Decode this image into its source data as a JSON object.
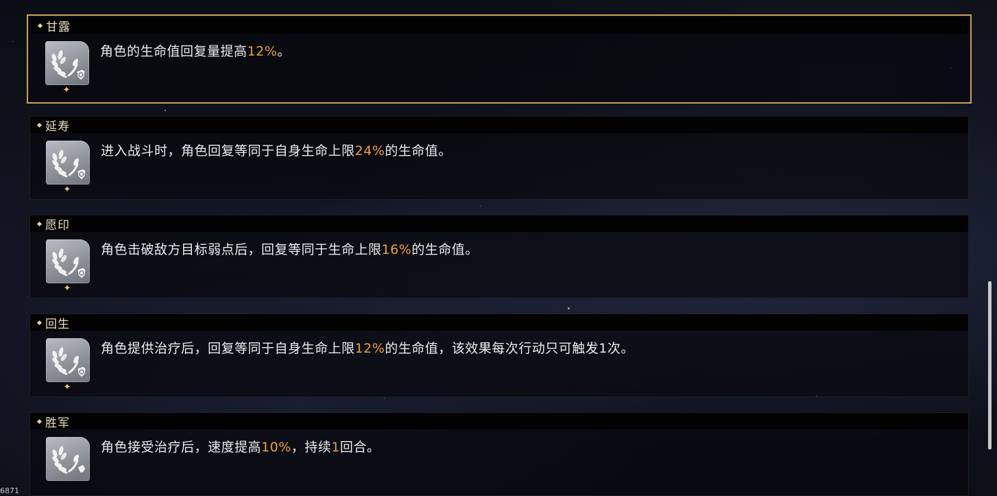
{
  "blessings": [
    {
      "name": "甘露",
      "selected": true,
      "desc_parts": [
        "角色的生命值回复量提高",
        "12%",
        "。"
      ]
    },
    {
      "name": "延寿",
      "selected": false,
      "desc_parts": [
        "进入战斗时，角色回复等同于自身生命上限",
        "24%",
        "的生命值。"
      ]
    },
    {
      "name": "愿印",
      "selected": false,
      "desc_parts": [
        "角色击破敌方目标弱点后，回复等同于生命上限",
        "16%",
        "的生命值。"
      ]
    },
    {
      "name": "回生",
      "selected": false,
      "desc_parts": [
        "角色提供治疗后，回复等同于自身生命上限",
        "12%",
        "的生命值，该效果每次行动只可触发1次。"
      ]
    },
    {
      "name": "胜军",
      "selected": false,
      "desc_parts": [
        "角色接受治疗后，速度提高",
        "10%",
        "，持续",
        "1",
        "回合。"
      ]
    }
  ],
  "corner_text": "6871",
  "colors": {
    "accent_gold": "#c8a25a",
    "highlight_orange": "#f0a032",
    "sparkle": "#f3c86a"
  },
  "icons": {
    "blessing_icon": "laurel-shield-icon",
    "rarity_icon": "sparkle-icon",
    "header_marker": "diamond-icon"
  }
}
